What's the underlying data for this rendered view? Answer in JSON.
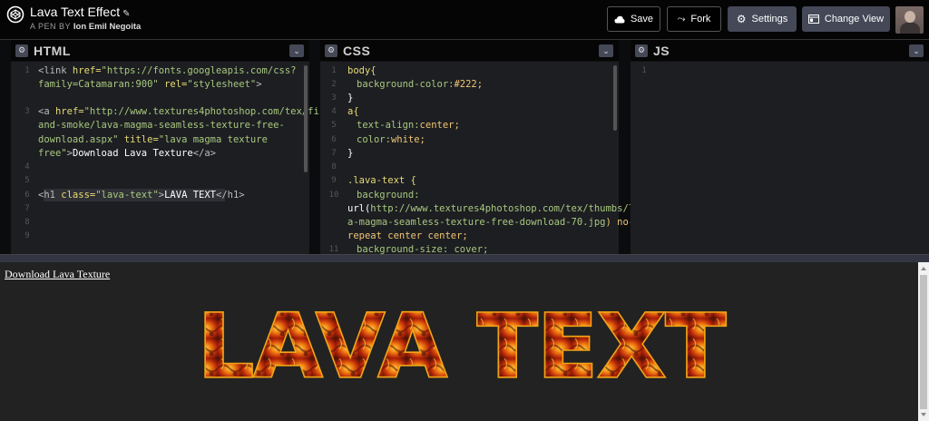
{
  "header": {
    "pen_title": "Lava Text Effect",
    "byline_prefix": "A PEN BY",
    "author": "Ion Emil Negoita",
    "buttons": {
      "save": "Save",
      "fork": "Fork",
      "settings": "Settings",
      "change_view": "Change View"
    }
  },
  "panes": {
    "html": {
      "title": "HTML",
      "line_numbers": [
        "1",
        "2",
        "3",
        "4",
        "5",
        "6",
        "7",
        "8",
        "9"
      ]
    },
    "css": {
      "title": "CSS",
      "line_numbers": [
        "1",
        "2",
        "3",
        "4",
        "5",
        "6",
        "7",
        "8",
        "9",
        "10",
        "11"
      ]
    },
    "js": {
      "title": "JS",
      "line_numbers": [
        "1"
      ]
    }
  },
  "html_code": {
    "l1a_tag": "<link",
    "l1a_attr": " href=",
    "l1a_str": "\"https://fonts.googleapis.com/css?",
    "l1b_str": "family=Catamaran:900\"",
    "l1b_attr": " rel=",
    "l1b_str2": "\"stylesheet\"",
    "l1b_tag": ">",
    "l3a_tag": "<a",
    "l3a_attr": " href=",
    "l3a_str": "\"http://www.textures4photoshop.com/tex/fire-",
    "l3b_str": "and-smoke/lava-magma-seamless-texture-free-",
    "l3c_str": "download.aspx\"",
    "l3c_attr": " title=",
    "l3c_str2": "\"lava magma texture",
    "l3d_str": "free\"",
    "l3d_tag": ">",
    "l3d_text": "Download Lava Texture",
    "l3d_close": "</a>",
    "l6_tag": "<h1",
    "l6_attr": " class=",
    "l6_str": "\"lava-text\"",
    "l6_tag2": ">",
    "l6_text": "LAVA TEXT",
    "l6_close": "</h1>"
  },
  "css_code": {
    "l1": "body{",
    "l2_prop": "background-color:",
    "l2_val": "#222;",
    "l3": "}",
    "l4": "a{",
    "l5_prop": "text-align:",
    "l5_val": "center;",
    "l6_prop": "color:",
    "l6_val": "white;",
    "l7": "}",
    "l9": ".lava-text {",
    "l10": "background:",
    "l10b_a": "url(",
    "l10b_b": "http://www.textures4photoshop.com/tex/thumbs/lav",
    "l10c": "a-magma-seamless-texture-free-download-70.jpg",
    "l10c_b": ") no-",
    "l10d": "repeat center center;",
    "l11": "background-size: cover;"
  },
  "preview": {
    "link_text": "Download Lava Texture",
    "heading": "LAVA TEXT"
  },
  "colors": {
    "lava_outline": "#f2a516",
    "lava_core": "#c93a0c",
    "editor_bg": "#1d1e22"
  }
}
